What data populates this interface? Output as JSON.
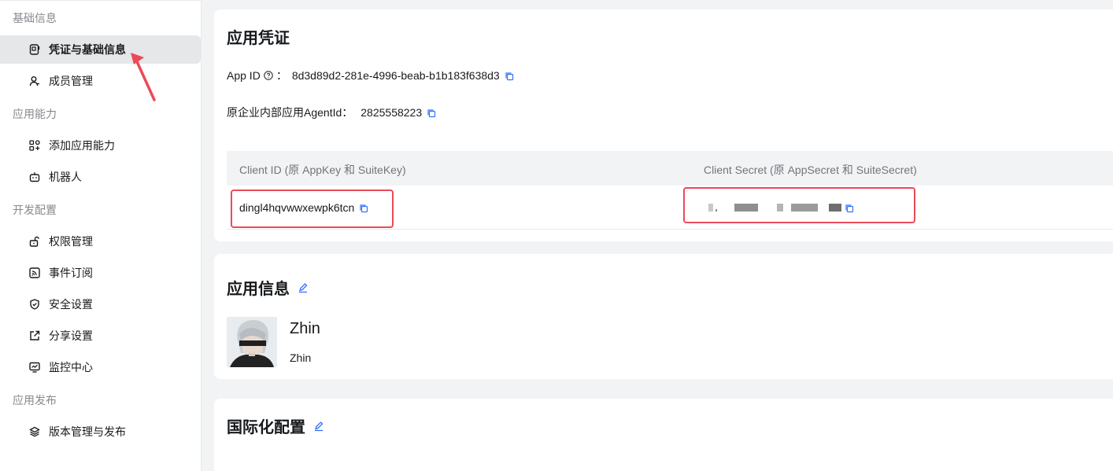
{
  "sidebar": {
    "groups": [
      {
        "title": "基础信息",
        "items": [
          {
            "label": "凭证与基础信息",
            "icon": "credential-icon",
            "active": true
          },
          {
            "label": "成员管理",
            "icon": "member-icon"
          }
        ]
      },
      {
        "title": "应用能力",
        "items": [
          {
            "label": "添加应用能力",
            "icon": "add-capability-icon"
          },
          {
            "label": "机器人",
            "icon": "robot-icon"
          }
        ]
      },
      {
        "title": "开发配置",
        "items": [
          {
            "label": "权限管理",
            "icon": "permission-icon"
          },
          {
            "label": "事件订阅",
            "icon": "event-subscription-icon"
          },
          {
            "label": "安全设置",
            "icon": "shield-icon"
          },
          {
            "label": "分享设置",
            "icon": "share-icon"
          },
          {
            "label": "监控中心",
            "icon": "monitor-icon"
          }
        ]
      },
      {
        "title": "应用发布",
        "items": [
          {
            "label": "版本管理与发布",
            "icon": "layers-icon"
          }
        ]
      }
    ]
  },
  "credentials": {
    "title": "应用凭证",
    "app_id_label": "App ID",
    "app_id_sep": "：",
    "app_id_value": "8d3d89d2-281e-4996-beab-b1b183f638d3",
    "agent_label": "原企业内部应用AgentId：",
    "agent_value": "2825558223",
    "table": {
      "col_client_id": "Client ID (原 AppKey 和 SuiteKey)",
      "col_client_secret": "Client Secret (原 AppSecret 和 SuiteSecret)",
      "client_id_value": "dingl4hqvwwxewpk6tcn"
    }
  },
  "app_info": {
    "title": "应用信息",
    "name": "Zhin",
    "description": "Zhin"
  },
  "intl": {
    "title": "国际化配置"
  },
  "colors": {
    "accent": "#3370ff",
    "highlight": "#ec4a58",
    "active_bg": "#e6e7e9"
  }
}
